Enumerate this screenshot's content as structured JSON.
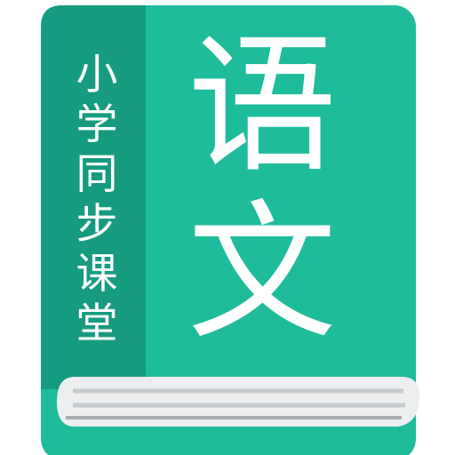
{
  "app_icon": {
    "subtitle_chars": [
      "小",
      "学",
      "同",
      "步",
      "课",
      "堂"
    ],
    "title_chars": [
      "语",
      "文"
    ],
    "colors": {
      "cover": "#1fbc9c",
      "spine": "#169b80",
      "pages": "#eceeef",
      "page_lines": "#c7cacc",
      "page_shadow": "#a9adb0",
      "text": "#ffffff"
    }
  }
}
